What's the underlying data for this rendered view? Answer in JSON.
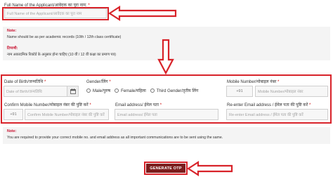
{
  "full_name": {
    "label": "Full Name of the Applicant/आवेदक का पूरा नाम:",
    "required_mark": "*",
    "placeholder": "Full Name of the Applicant/आवेदक का पूरा नाम"
  },
  "note1": {
    "title": "Note:",
    "line_en": "Name should be as per academic records (10th / 12th class certificate)",
    "title_hi": "टिप्पणी:",
    "line_hi": "नाम अकादमिक रिकॉर्ड के अनुसार होना चाहिए (10 वीं / 12 वीं कक्षा का प्रमाण पत्र)"
  },
  "dob": {
    "label": "Date of Birth/जन्मतिथि",
    "required_mark": "*",
    "placeholder": "Date of Birth/जन्मतिथि"
  },
  "gender": {
    "label": "Gender/लिंग",
    "required_mark": "*",
    "options": [
      "Male/पुरुष",
      "Female/महिला",
      "Third Gender/तृतीय लिंग"
    ]
  },
  "mobile": {
    "label": "Mobile Number/मोबाइल नंबर",
    "required_mark": "*",
    "prefix": "+91",
    "placeholder": "Mobile Number/मोबाइल नंबर"
  },
  "confirm_mobile": {
    "label": "Confirm Mobile Number/मोबाइल नंबर की पुष्टि करें",
    "required_mark": "*",
    "prefix": "+91",
    "placeholder": "Confirm Mobile Number/मोबाइल नंबर की पुष्टि करें"
  },
  "email": {
    "label": "Email address/ ईमेल पता",
    "required_mark": "*",
    "placeholder": "Email address/ ईमेल पता"
  },
  "reenter_email": {
    "label": "Re-enter Email address / ईमेल पता की पुष्टि करें",
    "required_mark": "*",
    "placeholder": "Re-enter Email address / ईमेल पता की पुष्टि करें"
  },
  "note2": {
    "title": "Note:",
    "line": "You are required to provide your correct mobile no. and email address as all important communications are to be sent using the same."
  },
  "generate_otp": {
    "label": "GENERATE OTP"
  },
  "colors": {
    "highlight": "#d8232a",
    "button": "#7b1d1d",
    "note_title": "#c8102e"
  }
}
